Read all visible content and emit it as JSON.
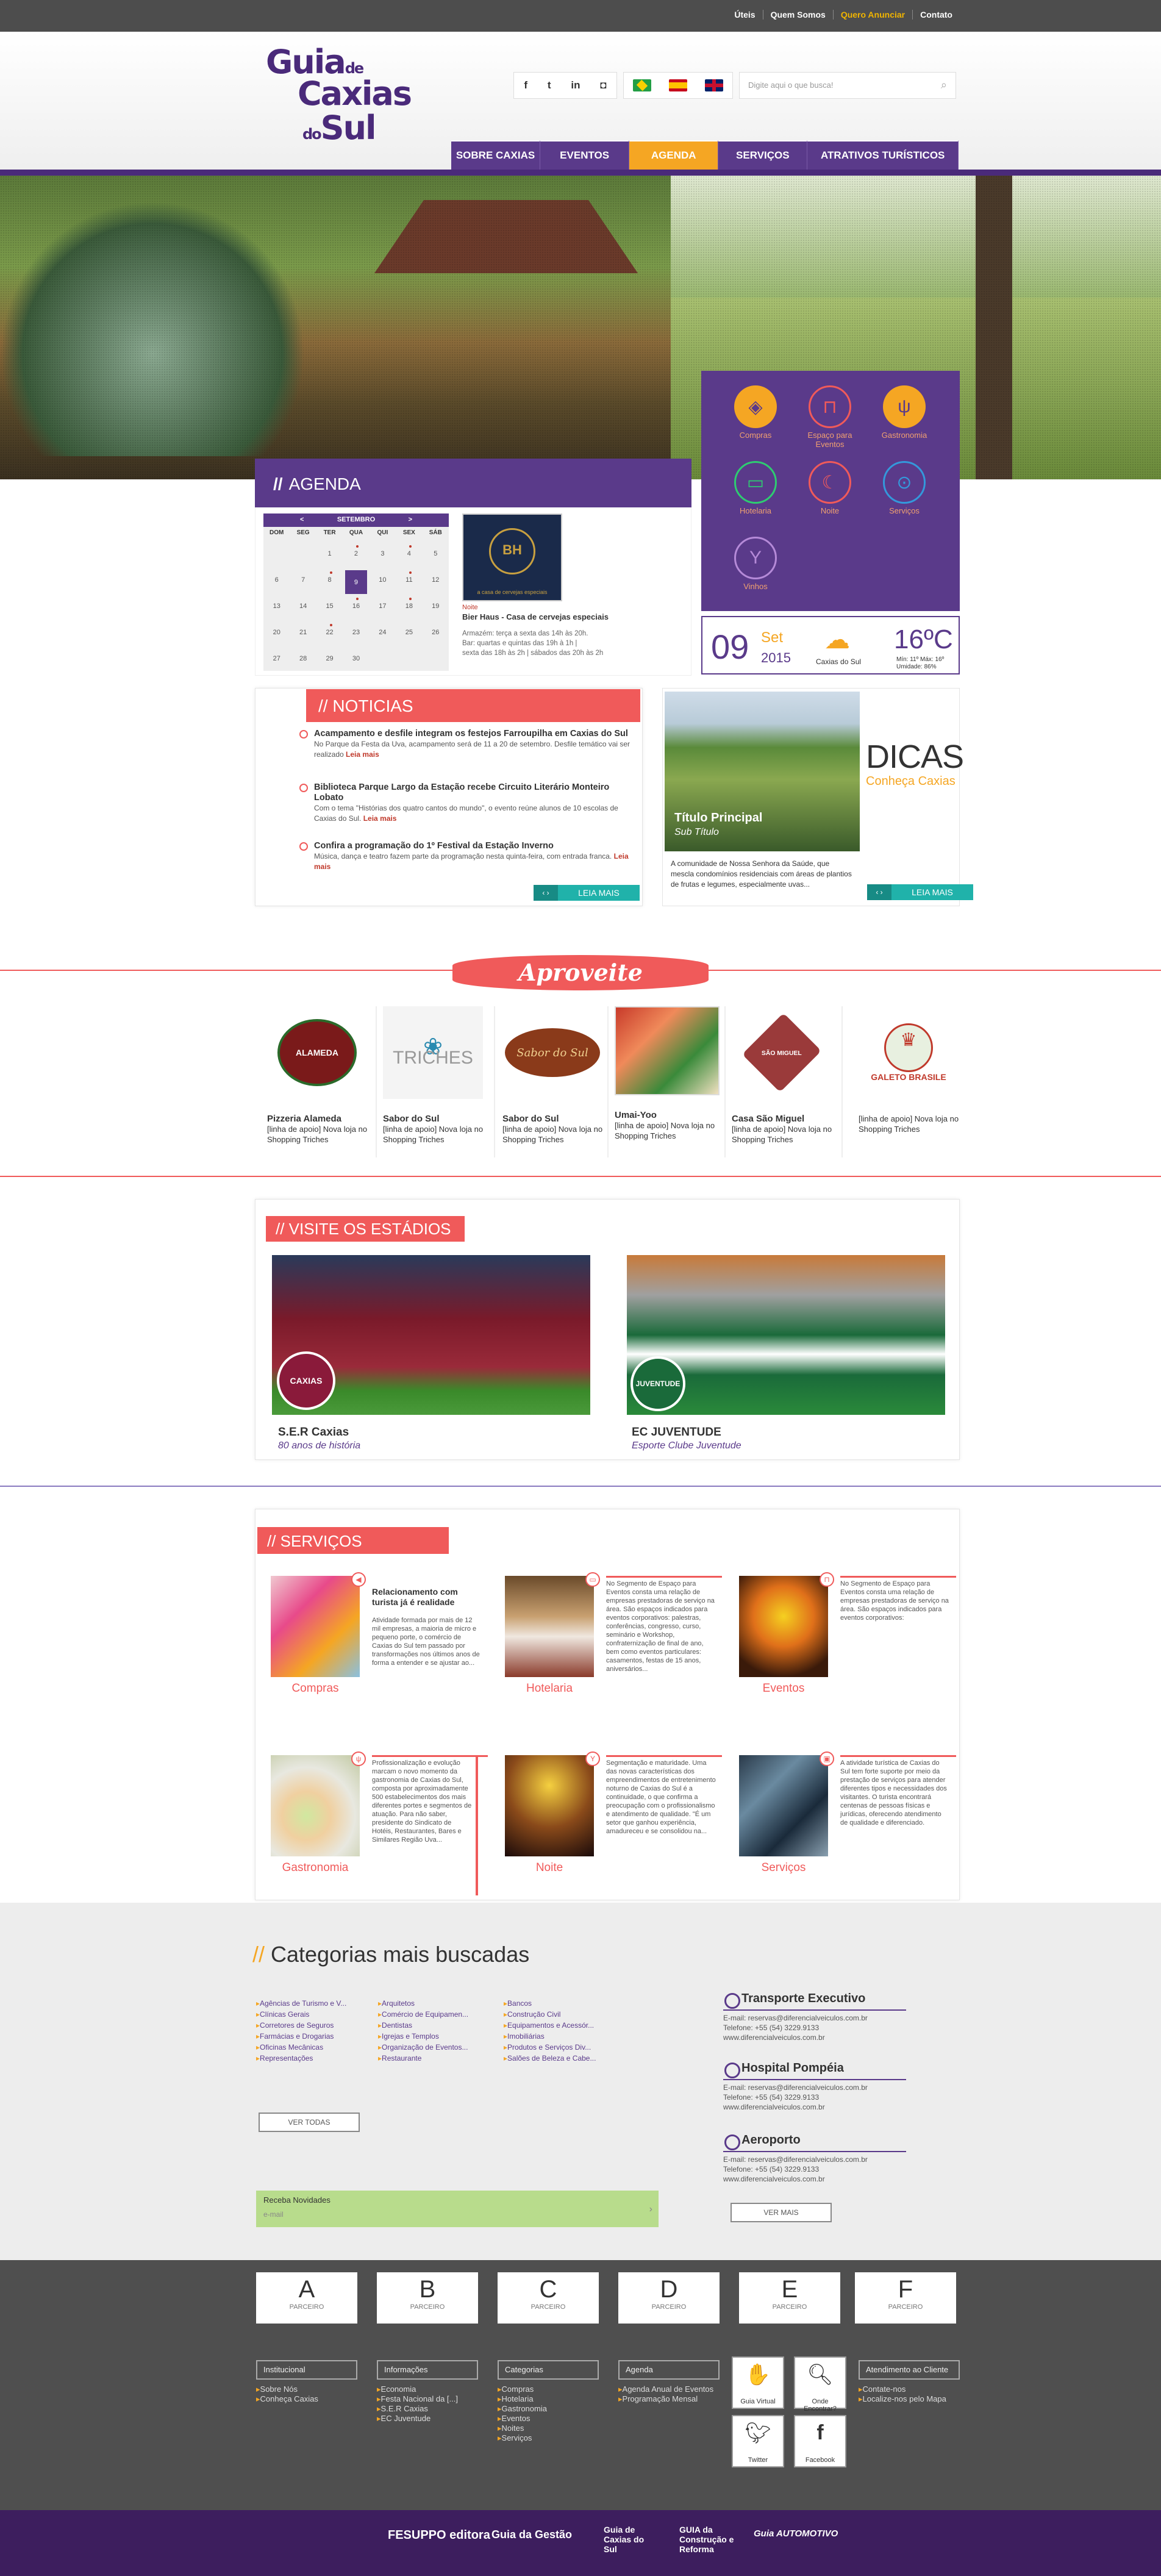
{
  "top_links": [
    "Úteis",
    "Quem Somos",
    "Quero Anunciar",
    "Contato"
  ],
  "logo": {
    "l1": "Guia",
    "l1s": "de",
    "l2": "Caxias",
    "l3s": "do",
    "l3": "Sul"
  },
  "social": [
    "f",
    "t",
    "in",
    "◘"
  ],
  "search_placeholder": "Digite aqui o que busca!",
  "nav": [
    "SOBRE CAXIAS",
    "EVENTOS",
    "AGENDA",
    "SERVIÇOS",
    "ATRATIVOS TURÍSTICOS"
  ],
  "agenda": {
    "title": "AGENDA",
    "month": "SETEMBRO",
    "days": [
      "DOM",
      "SEG",
      "TER",
      "QUA",
      "QUI",
      "SEX",
      "SÁB"
    ],
    "dates": [
      "",
      "",
      "1",
      "2",
      "3",
      "4",
      "5",
      "6",
      "7",
      "8",
      "9",
      "10",
      "11",
      "12",
      "13",
      "14",
      "15",
      "16",
      "17",
      "18",
      "19",
      "20",
      "21",
      "22",
      "23",
      "24",
      "25",
      "26",
      "27",
      "28",
      "29",
      "30",
      "",
      "",
      ""
    ],
    "event": {
      "tag": "Noite",
      "title": "Bier Haus - Casa de cervejas especiais",
      "details": "Armazém: terça a sexta das 14h às 20h.\nBar: quartas e quintas das 19h à 1h |\nsexta das 18h às 2h | sábados das 20h às 2h",
      "img_caption": "a casa de cervejas especiais"
    }
  },
  "categories": [
    {
      "label": "Compras",
      "icon": "tag-icon"
    },
    {
      "label": "Espaço para Eventos",
      "icon": "table-icon"
    },
    {
      "label": "Gastronomia",
      "icon": "cutlery-icon"
    },
    {
      "label": "Hotelaria",
      "icon": "bed-icon"
    },
    {
      "label": "Noite",
      "icon": "moon-icon"
    },
    {
      "label": "Serviços",
      "icon": "car-icon"
    },
    {
      "label": "Vinhos",
      "icon": "wine-glass-icon"
    }
  ],
  "weather": {
    "day": "09",
    "month": "Set",
    "year": "2015",
    "location": "Caxias do Sul",
    "temp": "16ºC",
    "minmax": "Mín: 11º Máx: 16º",
    "humidity": "Umidade: 86%"
  },
  "noticias": {
    "title": "NOTICIAS",
    "items": [
      {
        "h": "Acampamento e desfile integram os festejos Farroupilha em Caxias do Sul",
        "b": "No Parque da Festa da Uva, acampamento será de 11 a 20 de setembro. Desfile temático vai ser realizado",
        "lm": "Leia mais"
      },
      {
        "h": "Biblioteca Parque Largo da Estação recebe Circuito Literário Monteiro Lobato",
        "b": "Com o tema \"Histórias dos quatro cantos do mundo\", o evento reúne alunos de 10 escolas de Caxias do Sul.",
        "lm": "Leia mais"
      },
      {
        "h": "Confira a programação do 1º Festival da Estação Inverno",
        "b": "Música, dança e teatro fazem parte da programação nesta quinta-feira, com entrada franca.",
        "lm": "Leia mais"
      }
    ],
    "leia": "LEIA MAIS"
  },
  "dicas": {
    "img_title": "Título Principal",
    "img_sub": "Sub Título",
    "title": "DICAS",
    "sub": "Conheça Caxias",
    "text": "A comunidade de Nossa Senhora da Saúde, que mescla condomínios residenciais com áreas de plantios de frutas e legumes, especialmente uvas...",
    "leia": "LEIA MAIS"
  },
  "aproveite": {
    "title": "Aproveite",
    "items": [
      {
        "name": "Pizzeria Alameda",
        "desc": "[linha de apoio] Nova loja no Shopping Triches",
        "logo": "ALAMEDA"
      },
      {
        "name": "Sabor do Sul",
        "desc": "[linha de apoio] Nova loja no Shopping Triches",
        "logo": "TRICHES"
      },
      {
        "name": "Sabor do Sul",
        "desc": "[linha de apoio] Nova loja no Shopping Triches",
        "logo": "Sabor do Sul"
      },
      {
        "name": "Umai-Yoo",
        "desc": "[linha de apoio] Nova loja no Shopping Triches",
        "logo": ""
      },
      {
        "name": "Casa São Miguel",
        "desc": "[linha de apoio] Nova loja no Shopping Triches",
        "logo": "SÃO MIGUEL"
      },
      {
        "name": "",
        "desc": "[linha de apoio] Nova loja no Shopping Triches",
        "logo": "GALETO BRASILE"
      }
    ]
  },
  "estadios": {
    "title": "VISITE OS ESTÁDIOS",
    "items": [
      {
        "name": "S.E.R Caxias",
        "sub": "80 anos de história",
        "badge": "CAXIAS"
      },
      {
        "name": "EC JUVENTUDE",
        "sub": "Esporte Clube Juventude",
        "badge": "JUVENTUDE"
      }
    ]
  },
  "servicos": {
    "title": "SERVIÇOS",
    "items": [
      {
        "label": "Compras",
        "head": "Relacionamento com turista já é realidade",
        "text": "Atividade formada por mais de 12 mil empresas, a maioria de micro e pequeno porte, o comércio de Caxias do Sul tem passado por transformações nos últimos anos de forma a entender e se ajustar ao..."
      },
      {
        "label": "Hotelaria",
        "head": "",
        "text": "No Segmento de Espaço para Eventos consta uma relação de empresas prestadoras de serviço na área. São espaços indicados para eventos corporativos: palestras, conferências, congresso, curso, seminário e Workshop, confraternização de final de ano, bem como eventos particulares: casamentos, festas de 15 anos, aniversários..."
      },
      {
        "label": "Eventos",
        "head": "",
        "text": "No Segmento de Espaço para Eventos consta uma relação de empresas prestadoras de serviço na área. São espaços indicados para eventos corporativos:"
      },
      {
        "label": "Gastronomia",
        "head": "",
        "text": "Profissionalização e evolução marcam o novo momento da gastronomia de Caxias do Sul, composta por aproximadamente 500 estabelecimentos dos mais diferentes portes e segmentos de atuação. Para não saber, presidente do Sindicato de Hotéis, Restaurantes, Bares e Similares Região Uva..."
      },
      {
        "label": "Noite",
        "head": "",
        "text": "Segmentação e maturidade. Uma das novas características dos empreendimentos de entretenimento noturno de Caxias do Sul é a continuidade, o que confirma a preocupação com o profissionalismo e atendimento de qualidade. \"É um setor que ganhou experiência, amadureceu e se consolidou na..."
      },
      {
        "label": "Serviços",
        "head": "",
        "text": "A atividade turística de Caxias do Sul tem forte suporte por meio da prestação de serviços para atender diferentes tipos e necessidades dos visitantes. O turista encontrará centenas de pessoas físicas e jurídicas, oferecendo atendimento de qualidade e diferenciado."
      }
    ]
  },
  "cat_mais": {
    "title": "Categorias mais buscadas",
    "cols": [
      [
        "Agências de Turismo e V...",
        "Clínicas Gerais",
        "Corretores de Seguros",
        "Farmácias e Drogarias",
        "Oficinas Mecânicas",
        "Representações"
      ],
      [
        "Arquitetos",
        "Comércio de Equipamen...",
        "Dentistas",
        "Igrejas e Templos",
        "Organização de Eventos...",
        "Restaurante"
      ],
      [
        "Bancos",
        "Construção Civil",
        "Equipamentos e Acessór...",
        "Imobiliárias",
        "Produtos e Serviços Div...",
        "Salões de Beleza e Cabe..."
      ]
    ],
    "ver_todas": "VER TODAS"
  },
  "newsletter": {
    "title": "Receba Novidades",
    "placeholder": "e-mail"
  },
  "destaques": [
    {
      "h": "Transporte Executivo",
      "d": "E-mail: reservas@diferencialveiculos.com.br\nTelefone: +55 (54) 3229.9133\nwww.diferencialveiculos.com.br"
    },
    {
      "h": "Hospital Pompéia",
      "d": "E-mail: reservas@diferencialveiculos.com.br\nTelefone: +55 (54) 3229.9133\nwww.diferencialveiculos.com.br"
    },
    {
      "h": "Aeroporto",
      "d": "E-mail: reservas@diferencialveiculos.com.br\nTelefone: +55 (54) 3229.9133\nwww.diferencialveiculos.com.br"
    }
  ],
  "ver_mais": "VER MAIS",
  "parceiros": [
    {
      "letter": "A",
      "label": "PARCEIRO"
    },
    {
      "letter": "B",
      "label": "PARCEIRO"
    },
    {
      "letter": "C",
      "label": "PARCEIRO"
    },
    {
      "letter": "D",
      "label": "PARCEIRO"
    },
    {
      "letter": "E",
      "label": "PARCEIRO"
    },
    {
      "letter": "F",
      "label": "PARCEIRO"
    }
  ],
  "footer_cols": [
    {
      "h": "Institucional",
      "items": [
        "Sobre Nós",
        "Conheça Caxias"
      ]
    },
    {
      "h": "Informações",
      "items": [
        "Economia",
        "Festa Nacional da [...]",
        "S.E.R Caxias",
        "EC Juventude"
      ]
    },
    {
      "h": "Categorias",
      "items": [
        "Compras",
        "Hotelaria",
        "Gastronomia",
        "Eventos",
        "Noites",
        "Serviços"
      ]
    },
    {
      "h": "Agenda",
      "items": [
        "Agenda Anual de Eventos",
        "Programação Mensal"
      ]
    },
    {
      "h": "Atendimento ao Cliente",
      "items": [
        "Contate-nos",
        "Localize-nos pelo Mapa"
      ]
    }
  ],
  "footer_icons": [
    "Guia Virtual",
    "Onde Encontrar?",
    "Twitter",
    "Facebook"
  ],
  "brands": [
    "FESUPPO editora",
    "Guia da Gestão",
    "Guia de Caxias do Sul",
    "GUIA da Construção e Reforma",
    "Guia AUTOMOTIVO"
  ]
}
